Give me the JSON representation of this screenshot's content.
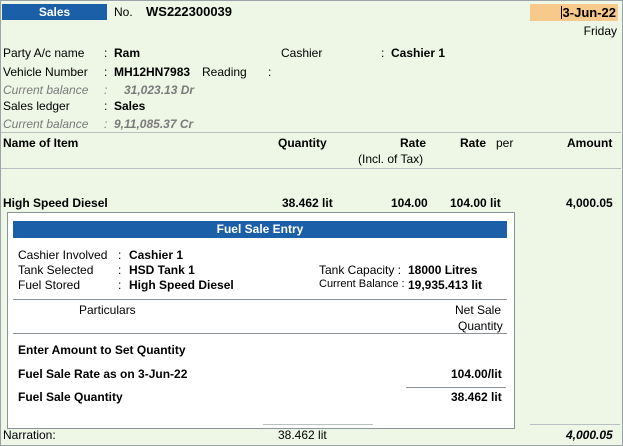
{
  "header": {
    "voucher_type": "Sales",
    "no_label": "No.",
    "voucher_no": "WS222300039",
    "date": "3-Jun-22",
    "day": "Friday"
  },
  "party": {
    "party_label": "Party A/c name",
    "party_value": "Ram",
    "cashier_label": "Cashier",
    "cashier_value": "Cashier 1",
    "vehicle_label": "Vehicle Number",
    "vehicle_value": "MH12HN7983",
    "reading_label": "Reading",
    "current_balance_label": "Current balance",
    "party_balance": "31,023.13 Dr",
    "sales_ledger_label": "Sales ledger",
    "sales_ledger_value": "Sales",
    "sales_balance": "9,11,085.37 Cr"
  },
  "table": {
    "col_item": "Name of Item",
    "col_quantity": "Quantity",
    "col_rate": "Rate",
    "col_rate_sub": "(Incl. of Tax)",
    "col_rate2": "Rate",
    "col_per": "per",
    "col_amount": "Amount",
    "row": {
      "item": "High Speed Diesel",
      "quantity": "38.462 lit",
      "rate": "104.00",
      "rate2": "104.00 lit",
      "amount": "4,000.05"
    }
  },
  "fuel_popup": {
    "title": "Fuel Sale Entry",
    "cashier_label": "Cashier Involved",
    "cashier_value": "Cashier 1",
    "tank_label": "Tank Selected",
    "tank_value": "HSD Tank 1",
    "fuel_label": "Fuel Stored",
    "fuel_value": "High Speed Diesel",
    "capacity_label": "Tank Capacity :",
    "capacity_value": "18000 Litres",
    "balance_label": "Current Balance :",
    "balance_value": "19,935.413 lit",
    "col_particulars": "Particulars",
    "col_net_sale_1": "Net Sale",
    "col_net_sale_2": "Quantity",
    "row1_label": "Enter Amount to Set Quantity",
    "row2_label": "Fuel Sale Rate as on 3-Jun-22",
    "row2_value": "104.00/lit",
    "row3_label": "Fuel Sale Quantity",
    "row3_value": "38.462 lit"
  },
  "footer": {
    "narration_label": "Narration:",
    "total_quantity": "38.462 lit",
    "total_amount": "4,000.05"
  }
}
